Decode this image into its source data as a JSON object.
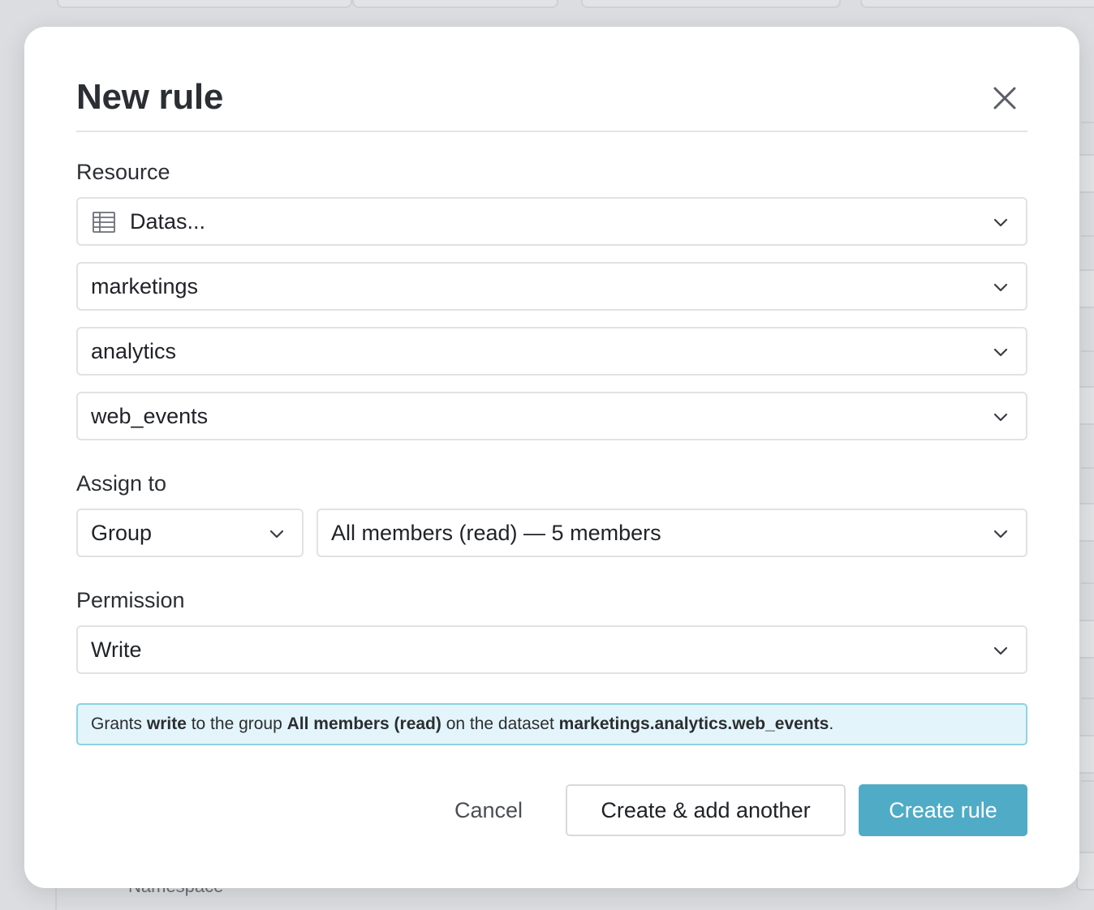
{
  "background": {
    "namespace_label": "Namespace",
    "right_glyph": "V"
  },
  "modal": {
    "title": "New rule",
    "resource": {
      "label": "Resource",
      "type_value": "Datas...",
      "type_icon": "table-icon",
      "workspace_value": "marketings",
      "namespace_value": "analytics",
      "dataset_value": "web_events"
    },
    "assign_to": {
      "label": "Assign to",
      "kind_value": "Group",
      "group_value": "All members (read) — 5 members"
    },
    "permission": {
      "label": "Permission",
      "value": "Write"
    },
    "summary": {
      "p1": "Grants ",
      "permission": "write",
      "p2": " to the group ",
      "group": "All members (read)",
      "p3": " on the dataset ",
      "dataset": "marketings.analytics.web_events",
      "p4": "."
    },
    "buttons": {
      "cancel": "Cancel",
      "create_another": "Create & add another",
      "create": "Create rule"
    }
  },
  "colors": {
    "primary": "#50abc6",
    "info_bg": "#e3f5fa",
    "info_border": "#8ed3e2"
  }
}
